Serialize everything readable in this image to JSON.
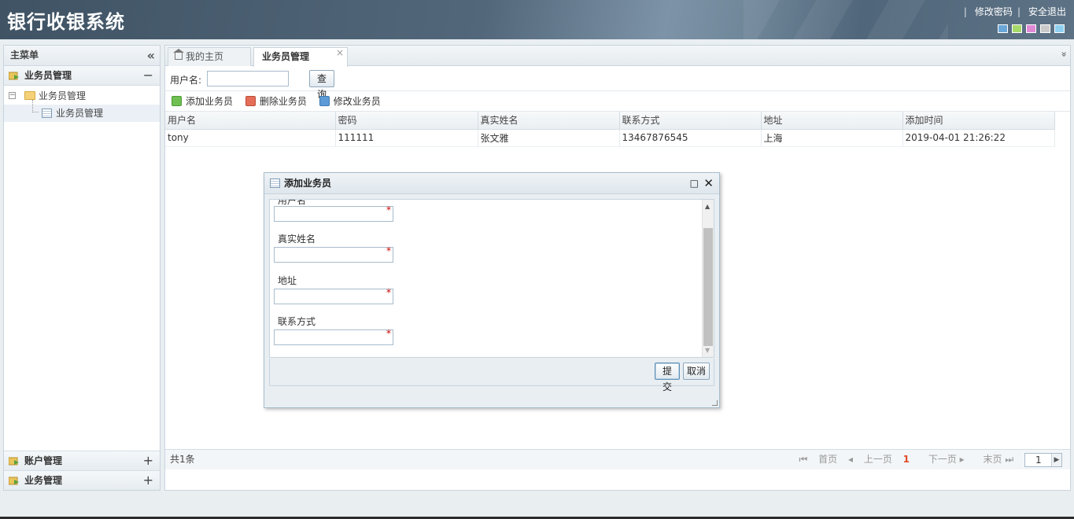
{
  "app": {
    "title": "银行收银系统"
  },
  "top_links": {
    "change_password": "修改密码",
    "logout": "安全退出",
    "separator": "|"
  },
  "theme_colors": [
    "#6aa6d8",
    "#a6d86a",
    "#e08ad6",
    "#c9c9c9",
    "#8fd0f0"
  ],
  "sidebar": {
    "title": "主菜单",
    "collapse_icon": "«",
    "active_group": {
      "label": "业务员管理",
      "toggle": "−"
    },
    "tree": {
      "root_label": "业务员管理",
      "child_label": "业务员管理"
    },
    "groups": [
      {
        "label": "账户管理",
        "toggle": "+"
      },
      {
        "label": "业务管理",
        "toggle": "+"
      }
    ]
  },
  "tabs": {
    "home": "我的主页",
    "active": "业务员管理",
    "close_icon": "×",
    "menu_icon": "»"
  },
  "search": {
    "label": "用户名:",
    "value": "",
    "button": "查询"
  },
  "toolbar": {
    "add": "添加业务员",
    "delete": "删除业务员",
    "edit": "修改业务员"
  },
  "grid": {
    "columns": [
      "用户名",
      "密码",
      "真实姓名",
      "联系方式",
      "地址",
      "添加时间"
    ],
    "rows": [
      [
        "tony",
        "111111",
        "张文雅",
        "13467876545",
        "上海",
        "2019-04-01 21:26:22"
      ]
    ]
  },
  "pagination": {
    "total": "共1条",
    "first": "首页",
    "prev": "上一页",
    "current": "1",
    "next": "下一页",
    "last": "末页",
    "page_value": "1"
  },
  "dialog": {
    "title": "添加业务员",
    "max_icon": "□",
    "close_icon": "✕",
    "fields": [
      {
        "label": "用户名",
        "value": "",
        "required_mark": "*"
      },
      {
        "label": "真实姓名",
        "value": "",
        "required_mark": "*"
      },
      {
        "label": "地址",
        "value": "",
        "required_mark": "*"
      },
      {
        "label": "联系方式",
        "value": "",
        "required_mark": "*"
      }
    ],
    "submit": "提交",
    "cancel": "取消"
  }
}
